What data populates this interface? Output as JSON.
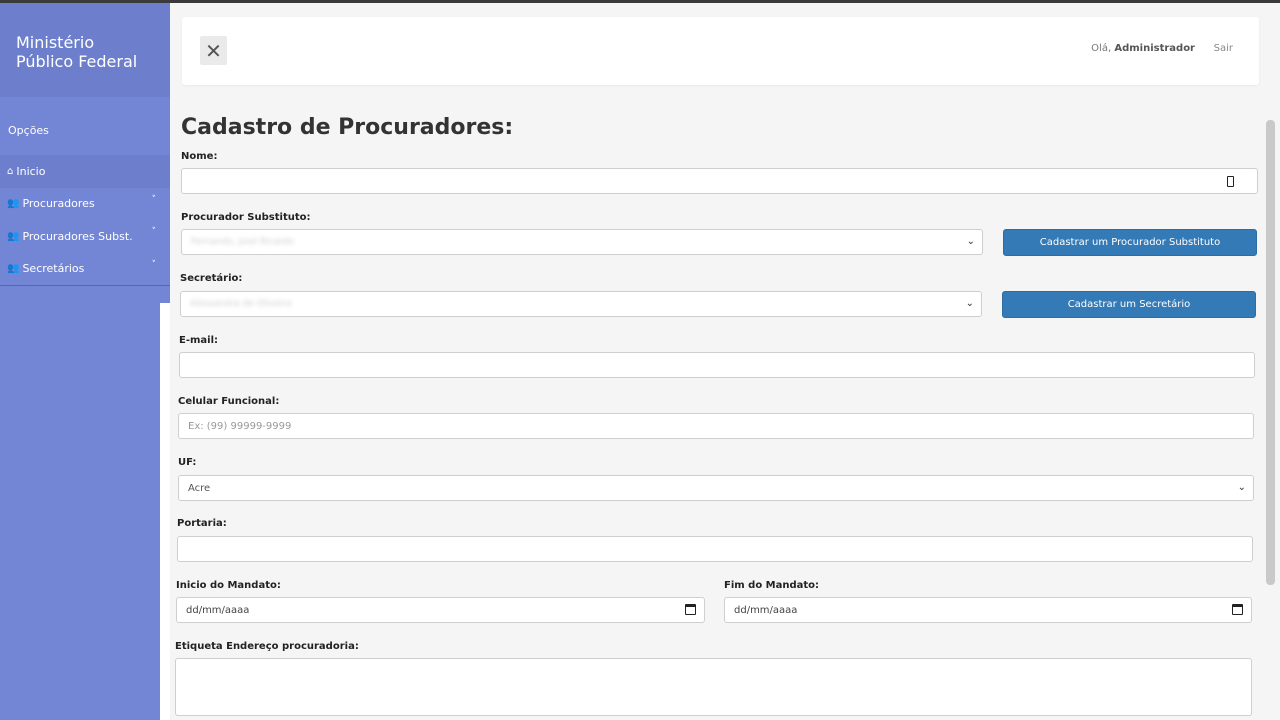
{
  "brand": {
    "line1": "Ministério",
    "line2": "Público Federal"
  },
  "sidebar": {
    "options_label": "Opções",
    "items": [
      {
        "label": "Inicio",
        "icon": "home-icon"
      },
      {
        "label": "Procuradores",
        "icon": "users-icon"
      },
      {
        "label": "Procuradores Subst.",
        "icon": "users-icon"
      },
      {
        "label": "Secretários",
        "icon": "users-icon"
      }
    ]
  },
  "header": {
    "close_glyph": "✕",
    "greeting_prefix": "Olá,",
    "user_name": "Administrador",
    "logout": "Sair"
  },
  "form": {
    "title": "Cadastro de Procuradores:",
    "nome_label": "Nome:",
    "substituto_label": "Procurador Substituto:",
    "substituto_value": "Fernando, José Ricardo",
    "substituto_button": "Cadastrar um Procurador Substituto",
    "secretario_label": "Secretário:",
    "secretario_value": "Alessandra de Oliveira",
    "secretario_button": "Cadastrar um Secretário",
    "email_label": "E-mail:",
    "celular_label": "Celular Funcional:",
    "celular_placeholder": "Ex: (99) 99999-9999",
    "uf_label": "UF:",
    "uf_value": "Acre",
    "portaria_label": "Portaria:",
    "inicio_label": "Inicio do Mandato:",
    "inicio_placeholder": "dd/mm/aaaa",
    "fim_label": "Fim do Mandato:",
    "fim_placeholder": "dd/mm/aaaa",
    "etiqueta_label": "Etiqueta Endereço procuradoria:"
  },
  "colors": {
    "sidebar": "#7386d5",
    "sidebar_header": "#6d7fcc",
    "button": "#337ab7"
  }
}
